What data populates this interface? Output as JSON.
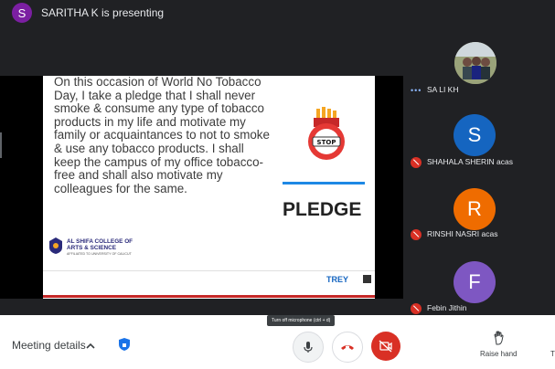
{
  "presenter": {
    "initial": "S",
    "text": "SARITHA K is presenting"
  },
  "slide": {
    "body": "On this occasion of World No Tobacco Day, I take a pledge that I shall never smoke & consume any type of tobacco products in my life and motivate my family or acquaintances to not to smoke & use any tobacco products. I shall keep the campus of my office tobacco- free and shall also motivate my colleagues for the same.",
    "stop_label": "STOP",
    "pledge_label": "PLEDGE",
    "college_line1": "AL SHIFA COLLEGE OF",
    "college_line2": "ARTS & SCIENCE",
    "college_sub": "AFFILIATED TO UNIVERSITY OF CALICUT",
    "footer_logo": "TREY"
  },
  "participants": [
    {
      "name": "SA LI KH",
      "initial": "",
      "color": "#8d8f78",
      "muted": false
    },
    {
      "name": "SHAHALA SHERIN acas",
      "initial": "S",
      "color": "#1565c0",
      "muted": true
    },
    {
      "name": "RINSHI NASRI acas",
      "initial": "R",
      "color": "#ef6c00",
      "muted": true
    },
    {
      "name": "Febin Jithin",
      "initial": "F",
      "color": "#7e57c2",
      "muted": true
    }
  ],
  "toolbar": {
    "meeting_details": "Meeting details",
    "tooltip": "Turn off microphone (ctrl + d)",
    "raise_hand": "Raise hand",
    "edge_label": "T"
  },
  "colors": {
    "end_call": "#d93025",
    "background": "#202124",
    "accent_blue": "#1e88e5"
  },
  "icons": [
    "chevron-up-icon",
    "shield-icon",
    "microphone-icon",
    "end-call-icon",
    "camera-off-icon",
    "raise-hand-icon",
    "mic-off-icon"
  ]
}
